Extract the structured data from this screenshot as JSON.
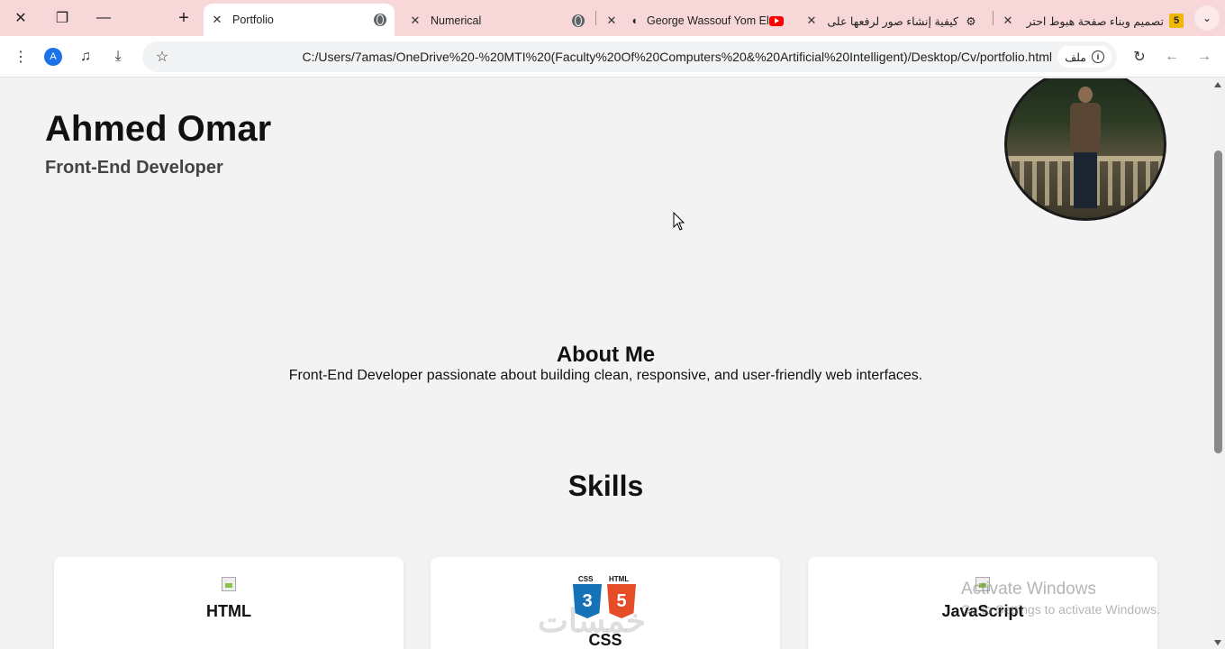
{
  "browser": {
    "tabs": [
      {
        "title": "Portfolio",
        "active": true,
        "icon": "globe-icon"
      },
      {
        "title": "Numerical",
        "active": false,
        "icon": "globe-icon"
      },
      {
        "title": "George Wassouf Yom El",
        "active": false,
        "icon": "youtube-icon"
      },
      {
        "title": "كيفية إنشاء صور لرفعها على",
        "active": false,
        "icon": "app-icon"
      },
      {
        "title": "تصميم وبناء صفحة هبوط احتر",
        "active": false,
        "icon": "khamsat-icon"
      }
    ],
    "url": "C:/Users/7amas/OneDrive%20-%20MTI%20(Faculty%20Of%20Computers%20&%20Artificial%20Intelligent)/Desktop/Cv/portfolio.html",
    "chip_label": "ملف",
    "profile_initial": "A"
  },
  "page": {
    "name": "Ahmed Omar",
    "role": "Front-End Developer",
    "about_title": "About Me",
    "about_text": "Front-End Developer passionate about building clean, responsive, and user-friendly web interfaces.",
    "skills_title": "Skills",
    "skills": [
      {
        "label": "HTML"
      },
      {
        "label": "CSS",
        "logo_left": "CSS",
        "logo_right": "HTML"
      },
      {
        "label": "JavaScript"
      }
    ]
  },
  "overlay": {
    "activate_title": "Activate Windows",
    "activate_sub": "Go to Settings to activate Windows.",
    "arabic_watermark": "خمسات"
  },
  "colors": {
    "tabstrip": "#f7d7d8",
    "page_bg": "#f3f3f3",
    "css_blue": "#1572b6",
    "html_orange": "#e44d26"
  }
}
